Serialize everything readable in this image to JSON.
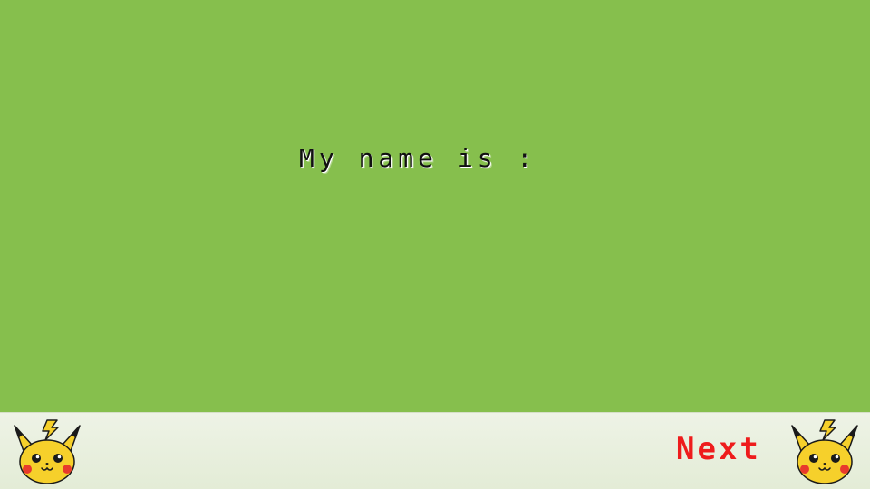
{
  "screen": {
    "prompt_text": "My name is :"
  },
  "footer": {
    "next_label": "Next"
  },
  "icons": {
    "left_mascot": "pikachu-face-icon",
    "right_mascot": "pikachu-face-icon"
  },
  "colors": {
    "background": "#86bf4d",
    "footer": "#e8eedf",
    "next": "#ee1c1c",
    "text": "#111111"
  }
}
